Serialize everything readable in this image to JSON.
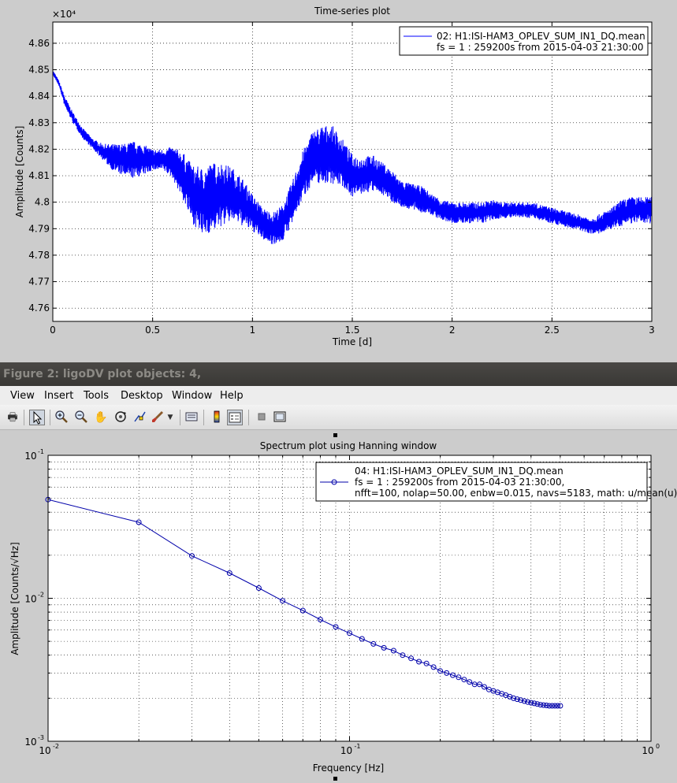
{
  "window": {
    "title": "Figure 2: ligoDV plot objects: 4,",
    "menu": [
      "View",
      "Insert",
      "Tools",
      "Desktop",
      "Window",
      "Help"
    ]
  },
  "toolbar_icons": [
    "print-icon",
    "pointer-icon",
    "zoom-in-icon",
    "zoom-out-icon",
    "pan-icon",
    "rotate-icon",
    "data-cursor-icon",
    "brush-icon",
    "brush-dropdown-icon",
    "link-icon",
    "colorbar-icon",
    "legend-icon",
    "hide-tools-icon",
    "dock-icon"
  ],
  "colors": {
    "series1": "#0000ff",
    "series2": "#0000aa",
    "axes_bg": "#ffffff",
    "figure_bg": "#cccccc"
  },
  "chart_data": [
    {
      "type": "line",
      "title": "Time-series plot",
      "xlabel": "Time [d]",
      "ylabel": "Amplitude [Counts]",
      "y_exponent": "×10⁴",
      "xlim": [
        0,
        3
      ],
      "ylim": [
        4.755,
        4.868
      ],
      "xticks": [
        "0",
        "0.5",
        "1",
        "1.5",
        "2",
        "2.5",
        "3"
      ],
      "yticks": [
        "4.76",
        "4.77",
        "4.78",
        "4.79",
        "4.8",
        "4.81",
        "4.82",
        "4.83",
        "4.84",
        "4.85",
        "4.86"
      ],
      "grid": true,
      "legend": {
        "position": "top-right",
        "lines": [
          "02: H1:ISI-HAM3_OPLEV_SUM_IN1_DQ.mean",
          "fs = 1 : 259200s from 2015-04-03 21:30:00"
        ]
      },
      "series": [
        {
          "x": [
            0,
            0.03,
            0.06,
            0.1,
            0.15,
            0.2,
            0.25,
            0.3,
            0.35,
            0.4,
            0.45,
            0.5,
            0.55,
            0.6,
            0.65,
            0.7,
            0.75,
            0.8,
            0.85,
            0.9,
            0.95,
            1.0,
            1.05,
            1.1,
            1.15,
            1.2,
            1.25,
            1.3,
            1.35,
            1.4,
            1.45,
            1.5,
            1.55,
            1.6,
            1.65,
            1.7,
            1.75,
            1.8,
            1.85,
            1.9,
            1.95,
            2.0,
            2.05,
            2.1,
            2.15,
            2.2,
            2.25,
            2.3,
            2.35,
            2.4,
            2.45,
            2.5,
            2.55,
            2.6,
            2.65,
            2.7,
            2.75,
            2.8,
            2.85,
            2.9,
            2.95,
            3.0
          ],
          "mean": [
            4.849,
            4.845,
            4.838,
            4.832,
            4.826,
            4.822,
            4.819,
            4.817,
            4.816,
            4.816,
            4.816,
            4.816,
            4.816,
            4.815,
            4.81,
            4.803,
            4.8,
            4.802,
            4.803,
            4.803,
            4.8,
            4.796,
            4.792,
            4.79,
            4.792,
            4.8,
            4.81,
            4.817,
            4.818,
            4.818,
            4.815,
            4.81,
            4.81,
            4.811,
            4.809,
            4.806,
            4.803,
            4.802,
            4.801,
            4.799,
            4.797,
            4.796,
            4.796,
            4.796,
            4.796,
            4.797,
            4.797,
            4.797,
            4.797,
            4.797,
            4.796,
            4.795,
            4.794,
            4.793,
            4.792,
            4.791,
            4.792,
            4.794,
            4.796,
            4.797,
            4.797,
            4.797
          ],
          "band": [
            0.001,
            0.001,
            0.002,
            0.002,
            0.002,
            0.002,
            0.003,
            0.005,
            0.006,
            0.007,
            0.006,
            0.004,
            0.004,
            0.006,
            0.009,
            0.011,
            0.013,
            0.013,
            0.012,
            0.01,
            0.009,
            0.007,
            0.006,
            0.006,
            0.007,
            0.008,
            0.009,
            0.01,
            0.011,
            0.011,
            0.009,
            0.008,
            0.007,
            0.007,
            0.006,
            0.006,
            0.005,
            0.005,
            0.005,
            0.004,
            0.004,
            0.004,
            0.004,
            0.004,
            0.004,
            0.004,
            0.003,
            0.003,
            0.003,
            0.003,
            0.003,
            0.003,
            0.003,
            0.003,
            0.003,
            0.003,
            0.004,
            0.004,
            0.005,
            0.005,
            0.005,
            0.005
          ]
        }
      ]
    },
    {
      "type": "line",
      "title": "Spectrum plot using Hanning window",
      "xlabel": "Frequency [Hz]",
      "ylabel": "Amplitude [Counts/√Hz]",
      "xscale": "log",
      "yscale": "log",
      "xlim": [
        0.01,
        1
      ],
      "ylim": [
        0.001,
        0.1
      ],
      "xtick_labels": [
        {
          "base": "10",
          "exp": "-2"
        },
        {
          "base": "10",
          "exp": "-1"
        },
        {
          "base": "10",
          "exp": "0"
        }
      ],
      "ytick_labels": [
        {
          "base": "10",
          "exp": "-1"
        },
        {
          "base": "10",
          "exp": "-2"
        },
        {
          "base": "10",
          "exp": "-3"
        }
      ],
      "grid": true,
      "marker": "circle",
      "legend": {
        "position": "top-right",
        "lines": [
          "04: H1:ISI-HAM3_OPLEV_SUM_IN1_DQ.mean",
          "fs = 1 : 259200s from 2015-04-03 21:30:00,",
          "nfft=100, nolap=50.00, enbw=0.015, navs=5183, math: u/mean(u)"
        ]
      },
      "series": [
        {
          "x": [
            0.01,
            0.02,
            0.03,
            0.04,
            0.05,
            0.06,
            0.07,
            0.08,
            0.09,
            0.1,
            0.11,
            0.12,
            0.13,
            0.14,
            0.15,
            0.16,
            0.17,
            0.18,
            0.19,
            0.2,
            0.21,
            0.22,
            0.23,
            0.24,
            0.25,
            0.26,
            0.27,
            0.28,
            0.29,
            0.3,
            0.31,
            0.32,
            0.33,
            0.34,
            0.35,
            0.36,
            0.37,
            0.38,
            0.39,
            0.4,
            0.41,
            0.42,
            0.43,
            0.44,
            0.45,
            0.46,
            0.47,
            0.48,
            0.49,
            0.5
          ],
          "y": [
            0.049,
            0.034,
            0.0198,
            0.015,
            0.0118,
            0.0096,
            0.0082,
            0.0071,
            0.0063,
            0.0057,
            0.0052,
            0.0048,
            0.0045,
            0.0043,
            0.004,
            0.0038,
            0.0036,
            0.0035,
            0.0033,
            0.0031,
            0.003,
            0.0029,
            0.0028,
            0.0027,
            0.0026,
            0.0025,
            0.0025,
            0.0024,
            0.0023,
            0.00225,
            0.0022,
            0.00215,
            0.0021,
            0.00205,
            0.002,
            0.00197,
            0.00194,
            0.00191,
            0.00188,
            0.00186,
            0.00184,
            0.00182,
            0.0018,
            0.00179,
            0.00178,
            0.00177,
            0.00177,
            0.00177,
            0.00177,
            0.00177
          ]
        }
      ]
    }
  ]
}
